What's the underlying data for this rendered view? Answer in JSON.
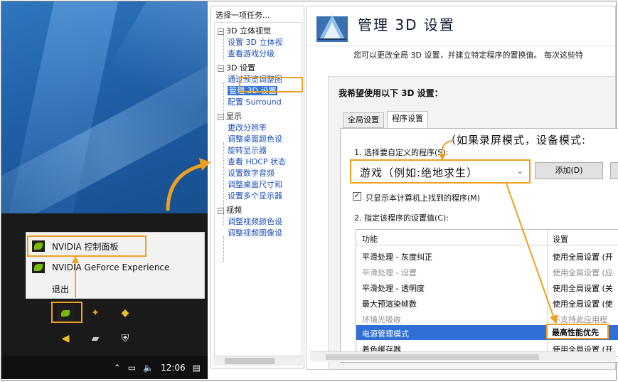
{
  "desktop": {
    "context_menu": {
      "items": [
        {
          "label": "NVIDIA 控制面板",
          "icon": "nvidia-icon"
        },
        {
          "label": "NVIDIA GeForce Experience",
          "icon": "geforce-icon"
        },
        {
          "label": "退出"
        }
      ]
    },
    "taskbar": {
      "clock": "12:06"
    }
  },
  "task_tree": {
    "title": "选择一项任务...",
    "groups": [
      {
        "label": "3D 立体视觉",
        "items": [
          "设置 3D 立体视",
          "查看游戏分级"
        ]
      },
      {
        "label": "3D 设置",
        "items": [
          "通过预览调整图",
          "管理 3D 设置",
          "配置 Surround"
        ]
      },
      {
        "label": "显示",
        "items": [
          "更改分辨率",
          "调整桌面颜色设",
          "旋转显示器",
          "查看 HDCP 状态",
          "设置数字音频",
          "调整桌面尺寸和",
          "设置多个显示器"
        ]
      },
      {
        "label": "视频",
        "items": [
          "调整视频颜色设",
          "调整视频图像设"
        ]
      }
    ]
  },
  "main": {
    "title": "管理 3D 设置",
    "description": "您可以更改全局 3D 设置，并建立特定程序的置换值。 每次这些特",
    "section_label": "我希望使用以下 3D 设置：",
    "tabs": [
      "全局设置",
      "程序设置"
    ],
    "annotation": "（如果录屏模式，设备模式:",
    "step1_label": "1. 选择要自定义的程序(S):",
    "program_select": "游戏（例如:绝地求生）",
    "add_button": "添加(D)",
    "show_only_checkbox": {
      "checked": true,
      "label": "只显示本计算机上找到的程序(M)"
    },
    "step2_label": "2. 指定该程序的设置值(C):",
    "grid": {
      "headers": [
        "功能",
        "设置"
      ],
      "rows": [
        {
          "feature": "平滑处理 - 灰度纠正",
          "value": "使用全局设置 (开",
          "state": "normal"
        },
        {
          "feature": "平滑处理 - 设置",
          "value": "使用全局设置 (应",
          "state": "dim"
        },
        {
          "feature": "平滑处理 - 透明度",
          "value": "使用全局设置 (关",
          "state": "normal"
        },
        {
          "feature": "最大预渲染帧数",
          "value": "使用全局设置 (使",
          "state": "normal"
        },
        {
          "feature": "环境光吸收",
          "value": "不支持此应用程",
          "state": "dim"
        },
        {
          "feature": "电源管理模式",
          "value": "最高性能优先",
          "state": "selected"
        },
        {
          "feature": "着色缓存器",
          "value": "使用全局设置 (开",
          "state": "normal"
        }
      ]
    }
  },
  "colors": {
    "highlight": "#f0a020",
    "selection": "#2f6fd6",
    "tree_link": "#1a4dbb"
  }
}
